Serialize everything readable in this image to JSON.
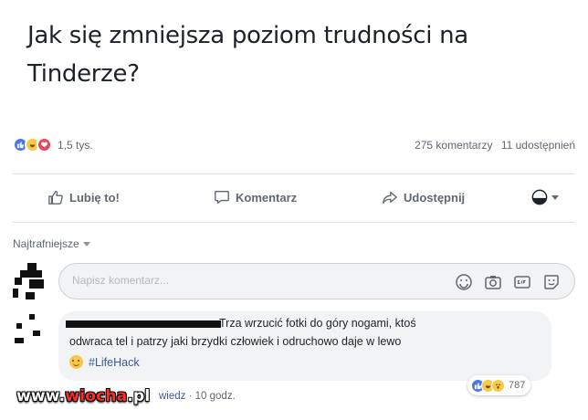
{
  "post": {
    "text": "Jak się zmniejsza poziom trudności na Tinderze?"
  },
  "stats": {
    "reactions_count": "1,5 tys.",
    "comments": "275 komentarzy",
    "shares": "11 udostępnień",
    "reaction_icons": [
      "like-icon",
      "haha-icon",
      "love-icon"
    ]
  },
  "actions": {
    "like": "Lubię to!",
    "comment": "Komentarz",
    "share": "Udostępnij"
  },
  "comments_section": {
    "sort_label": "Najtrafniejsze",
    "input_placeholder": "Napisz komentarz...",
    "tools": [
      "emoji-icon",
      "camera-icon",
      "gif-icon",
      "sticker-icon"
    ]
  },
  "comment": {
    "line1": "Trza wrzucić fotki do góry nogami, ktoś",
    "line2": "odwraca tel i patrzy jaki brzydki człowiek i odruchowo daje w lewo",
    "hashtag": "#LifeHack",
    "reaction_count": "787",
    "reply_label": "wiedz",
    "time": "10 godz."
  },
  "watermark": {
    "prefix": "www.",
    "accent": "wiocha",
    "suffix": ".pl"
  },
  "colors": {
    "like": "#4a76e8",
    "love": "#e9455b",
    "haha": "#f7c84a",
    "link": "#385898",
    "muted": "#606770"
  }
}
